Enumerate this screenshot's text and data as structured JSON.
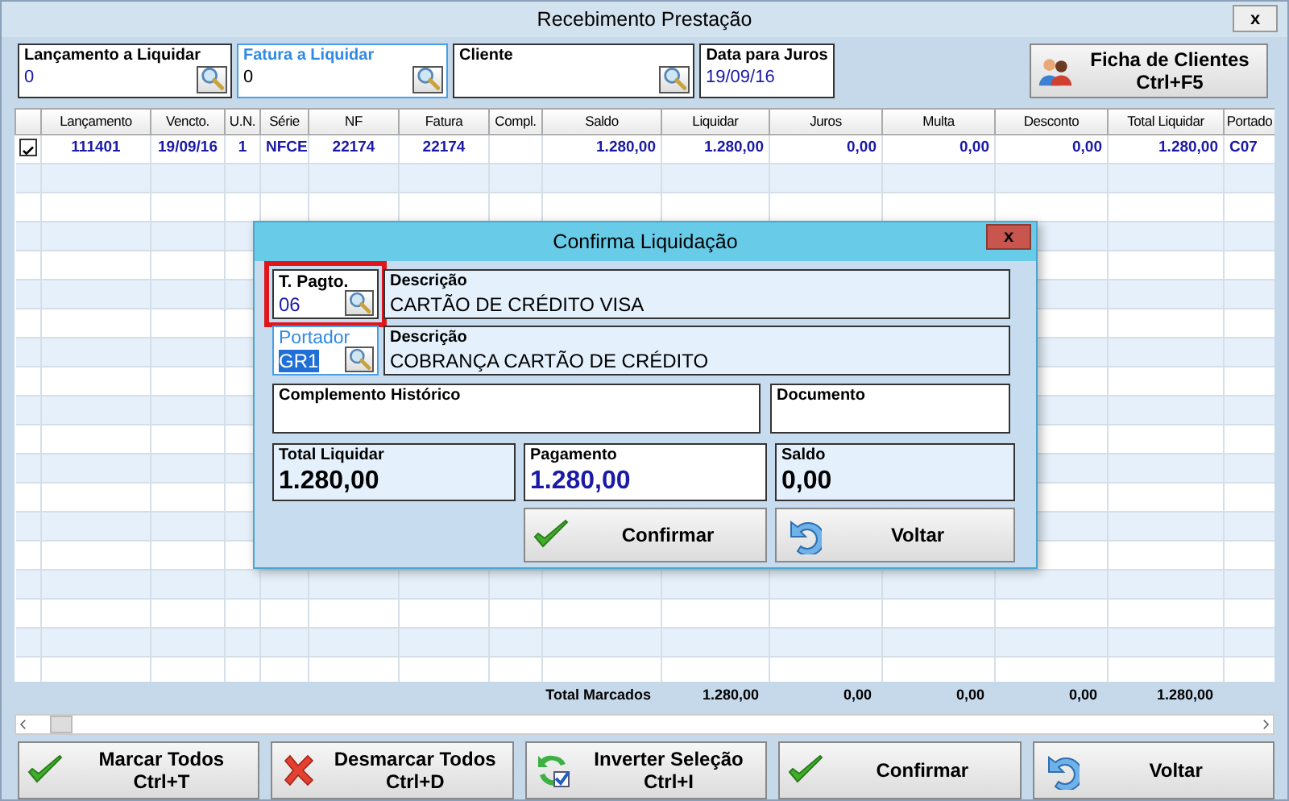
{
  "window": {
    "title": "Recebimento Prestação",
    "close": "x"
  },
  "filters": [
    {
      "label": "Lançamento a Liquidar",
      "value": "0",
      "focused": false
    },
    {
      "label": "Fatura a Liquidar",
      "value": "0",
      "focused": true
    },
    {
      "label": "Cliente",
      "focused": false
    }
  ],
  "interest_date": {
    "label": "Data para Juros",
    "value": "19/09/16"
  },
  "client_button": {
    "label": "Ficha de Clientes",
    "shortcut": "Ctrl+F5"
  },
  "table": {
    "columns": [
      "Lançamento",
      "Vencto.",
      "U.N.",
      "Série",
      "NF",
      "Fatura",
      "Compl.",
      "Saldo",
      "Liquidar",
      "Juros",
      "Multa",
      "Desconto",
      "Total Liquidar",
      "Portado"
    ],
    "rows": [
      {
        "checked": true,
        "cells": [
          "111401",
          "19/09/16",
          "1",
          "NFCE",
          "22174",
          "22174",
          "",
          "1.280,00",
          "1.280,00",
          "0,00",
          "0,00",
          "0,00",
          "1.280,00",
          "C07"
        ]
      }
    ],
    "totals": {
      "label": "Total Marcados",
      "values": [
        "1.280,00",
        "0,00",
        "0,00",
        "0,00",
        "1.280,00"
      ]
    }
  },
  "buttons": [
    {
      "label": "Marcar Todos",
      "shortcut": "Ctrl+T",
      "kind": "check"
    },
    {
      "label": "Desmarcar Todos",
      "shortcut": "Ctrl+D",
      "kind": "cross"
    },
    {
      "label": "Inverter Seleção",
      "shortcut": "Ctrl+I",
      "kind": "cycle"
    },
    {
      "label": "Confirmar",
      "kind": "check"
    },
    {
      "label": "Voltar",
      "kind": "undo"
    }
  ],
  "dialog": {
    "title": "Confirma Liquidação",
    "close": "x",
    "payment_type": {
      "label": "T. Pagto.",
      "value": "06",
      "highlighted": true,
      "focused": false
    },
    "payment_description": {
      "label": "Descrição",
      "value": "CARTÃO DE CRÉDITO VISA"
    },
    "carrier": {
      "label": "Portador",
      "value": "GR1",
      "highlighted": false,
      "focused": true
    },
    "carrier_description": {
      "label": "Descrição",
      "value": "COBRANÇA CARTÃO DE CRÉDITO"
    },
    "history": {
      "label": "Complemento Histórico"
    },
    "document": {
      "label": "Documento"
    },
    "amounts": [
      {
        "label": "Total Liquidar",
        "value": "1.280,00",
        "editable": false
      },
      {
        "label": "Pagamento",
        "value": "1.280,00",
        "editable": true
      },
      {
        "label": "Saldo",
        "value": "0,00",
        "editable": false
      }
    ],
    "buttons": [
      {
        "label": "Confirmar",
        "kind": "check"
      },
      {
        "label": "Voltar",
        "kind": "undo"
      }
    ]
  }
}
